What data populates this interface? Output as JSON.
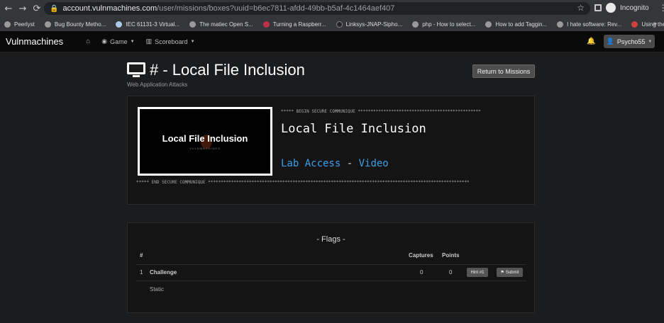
{
  "browser": {
    "url_domain": "account.vulnmachines.com",
    "url_path": "/user/missions/boxes?uuid=b6ec7811-afdd-49bb-b5af-4c1464aef407",
    "profile_label": "Incognito",
    "bookmarks": [
      "Peerlyst",
      "Bug Bounty Metho...",
      "IEC 61131-3 Virtual...",
      "The matiec Open S...",
      "Turning a Raspberr...",
      "Linksys-JNAP-Sipho...",
      "php - How to select...",
      "How to add Taggin...",
      "I hate software: Rev...",
      "Using the GNU Co..."
    ],
    "bookmarks_more": "»"
  },
  "navbar": {
    "brand": "Vulnmachines",
    "game_label": "Game",
    "scoreboard_label": "Scoreboard",
    "user_label": "Psycho55"
  },
  "page": {
    "title": "# - Local File Inclusion",
    "subtitle": "Web Application Attacks",
    "return_label": "Return to Missions"
  },
  "lab": {
    "thumb_title": "Local File Inclusion",
    "thumb_sub": "VULNMACHINES",
    "begin_line": "***** BEGIN SECURE COMMUNIQUE ************************************************",
    "title": "Local File Inclusion",
    "lab_access_label": "Lab Access",
    "separator": " - ",
    "video_label": "Video",
    "end_line": "***** END SECURE COMMUNIQUE ******************************************************************************************************"
  },
  "flags": {
    "heading": "- Flags -",
    "col_num": "#",
    "col_captures": "Captures",
    "col_points": "Points",
    "row": {
      "num": "1",
      "name": "Challenge",
      "captures": "0",
      "points": "0",
      "hint_label": "Hint #1",
      "submit_label": "Submit",
      "type": "Static"
    }
  }
}
